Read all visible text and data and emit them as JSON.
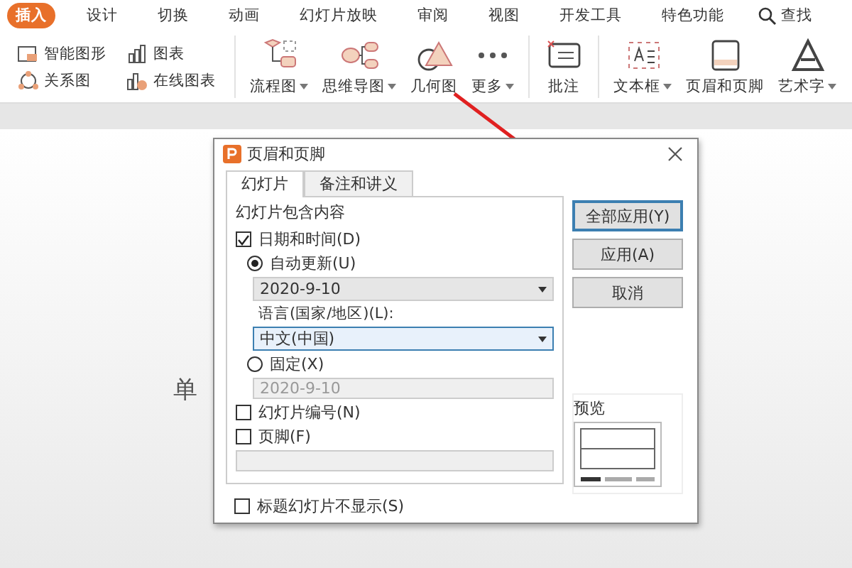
{
  "ribbon_tabs": [
    {
      "label": "插入",
      "selected": true
    },
    {
      "label": "设计",
      "selected": false
    },
    {
      "label": "切换",
      "selected": false
    },
    {
      "label": "动画",
      "selected": false
    },
    {
      "label": "幻灯片放映",
      "selected": false
    },
    {
      "label": "审阅",
      "selected": false
    },
    {
      "label": "视图",
      "selected": false
    },
    {
      "label": "开发工具",
      "selected": false
    },
    {
      "label": "特色功能",
      "selected": false
    }
  ],
  "search": {
    "label": "查找"
  },
  "small_tools": [
    {
      "label": "智能图形"
    },
    {
      "label": "关系图"
    },
    {
      "label": "图表"
    },
    {
      "label": "在线图表"
    }
  ],
  "large_tools": [
    {
      "label": "流程图",
      "dropdown": true
    },
    {
      "label": "思维导图",
      "dropdown": true
    },
    {
      "label": "几何图",
      "dropdown": false
    },
    {
      "label": "更多",
      "dropdown": true
    },
    {
      "label": "批注",
      "dropdown": false
    },
    {
      "label": "文本框",
      "dropdown": true
    },
    {
      "label": "页眉和页脚",
      "dropdown": false
    },
    {
      "label": "艺术字",
      "dropdown": true
    }
  ],
  "slide": {
    "subtitle_fragment": "单"
  },
  "dialog": {
    "title": "页眉和页脚",
    "tabs": [
      {
        "label": "幻灯片",
        "selected": true
      },
      {
        "label": "备注和讲义",
        "selected": false
      }
    ],
    "group_label": "幻灯片包含内容",
    "date_time": {
      "label": "日期和时间(D)",
      "checked": true
    },
    "auto_update": {
      "label": "自动更新(U)",
      "selected": true
    },
    "auto_date": {
      "value": "2020-9-10"
    },
    "language_label": "语言(国家/地区)(L):",
    "language": {
      "value": "中文(中国)",
      "focused": true
    },
    "fixed": {
      "label": "固定(X)",
      "selected": false
    },
    "fixed_date": {
      "value": "2020-9-10",
      "disabled": true
    },
    "slide_number": {
      "label": "幻灯片编号(N)",
      "checked": false
    },
    "footer": {
      "label": "页脚(F)",
      "checked": false
    },
    "footer_text": {
      "disabled": true
    },
    "title_slide_hidden": {
      "label": "标题幻灯片不显示(S)",
      "checked": false
    },
    "buttons": [
      {
        "label": "全部应用(Y)",
        "default": true
      },
      {
        "label": "应用(A)",
        "default": false
      },
      {
        "label": "取消",
        "default": false
      }
    ],
    "preview_label": "预览"
  }
}
